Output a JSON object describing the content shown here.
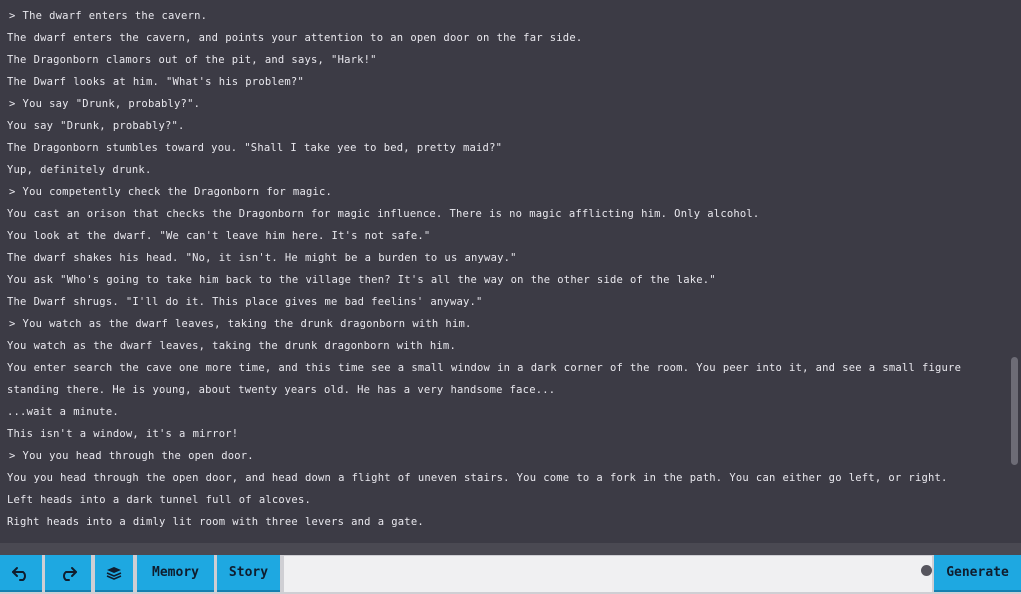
{
  "story": {
    "lines": [
      {
        "kind": "action",
        "text": "> The dwarf enters the cavern."
      },
      {
        "kind": "text",
        "text": "The dwarf enters the cavern, and points your attention to an open door on the far side."
      },
      {
        "kind": "text",
        "text": "The Dragonborn clamors out of the pit, and says, \"Hark!\""
      },
      {
        "kind": "text",
        "text": "The Dwarf looks at him. \"What's his problem?\""
      },
      {
        "kind": "action",
        "text": "> You say \"Drunk, probably?\"."
      },
      {
        "kind": "text",
        "text": "You say \"Drunk, probably?\"."
      },
      {
        "kind": "text",
        "text": "The Dragonborn stumbles toward you. \"Shall I take yee to bed, pretty maid?\""
      },
      {
        "kind": "text",
        "text": "Yup, definitely drunk."
      },
      {
        "kind": "action",
        "text": "> You competently check the Dragonborn for magic."
      },
      {
        "kind": "text",
        "text": "You cast an orison that checks the Dragonborn for magic influence. There is no magic afflicting him. Only alcohol."
      },
      {
        "kind": "text",
        "text": "You look at the dwarf. \"We can't leave him here. It's not safe.\""
      },
      {
        "kind": "text",
        "text": "The dwarf shakes his head. \"No, it isn't. He might be a burden to us anyway.\""
      },
      {
        "kind": "text",
        "text": "You ask \"Who's going to take him back to the village then? It's all the way on the other side of the lake.\""
      },
      {
        "kind": "text",
        "text": "The Dwarf shrugs. \"I'll do it. This place gives me bad feelins' anyway.\""
      },
      {
        "kind": "action",
        "text": "> You watch as the dwarf leaves, taking the drunk dragonborn with him."
      },
      {
        "kind": "text",
        "text": "You watch as the dwarf leaves, taking the drunk dragonborn with him."
      },
      {
        "kind": "text",
        "text": "You enter search the cave one more time, and this time see a small window in a dark corner of the room. You peer into it, and see a small figure standing there. He is young, about twenty years old. He has a very handsome face..."
      },
      {
        "kind": "text",
        "text": "...wait a minute."
      },
      {
        "kind": "text",
        "text": "This isn't a window, it's a mirror!"
      },
      {
        "kind": "action",
        "text": "> You you head through the open door."
      },
      {
        "kind": "text",
        "text": "You you head through the open door, and head down a flight of uneven stairs. You come to a fork in the path. You can either go left, or right."
      },
      {
        "kind": "text",
        "text": "Left heads into a dark tunnel full of alcoves."
      },
      {
        "kind": "text",
        "text": "Right heads into a dimly lit room with three levers and a gate."
      }
    ]
  },
  "toolbar": {
    "undo_icon": "undo-icon",
    "redo_icon": "redo-icon",
    "layers_icon": "layers-icon",
    "memory_label": "Memory",
    "story_label": "Story",
    "input_value": "",
    "input_placeholder": "",
    "generate_label": "Generate"
  },
  "colors": {
    "background": "#3c3b45",
    "text": "#e9e8ee",
    "accent": "#1ea8e1",
    "bottom_bar": "#cfcfd4"
  }
}
